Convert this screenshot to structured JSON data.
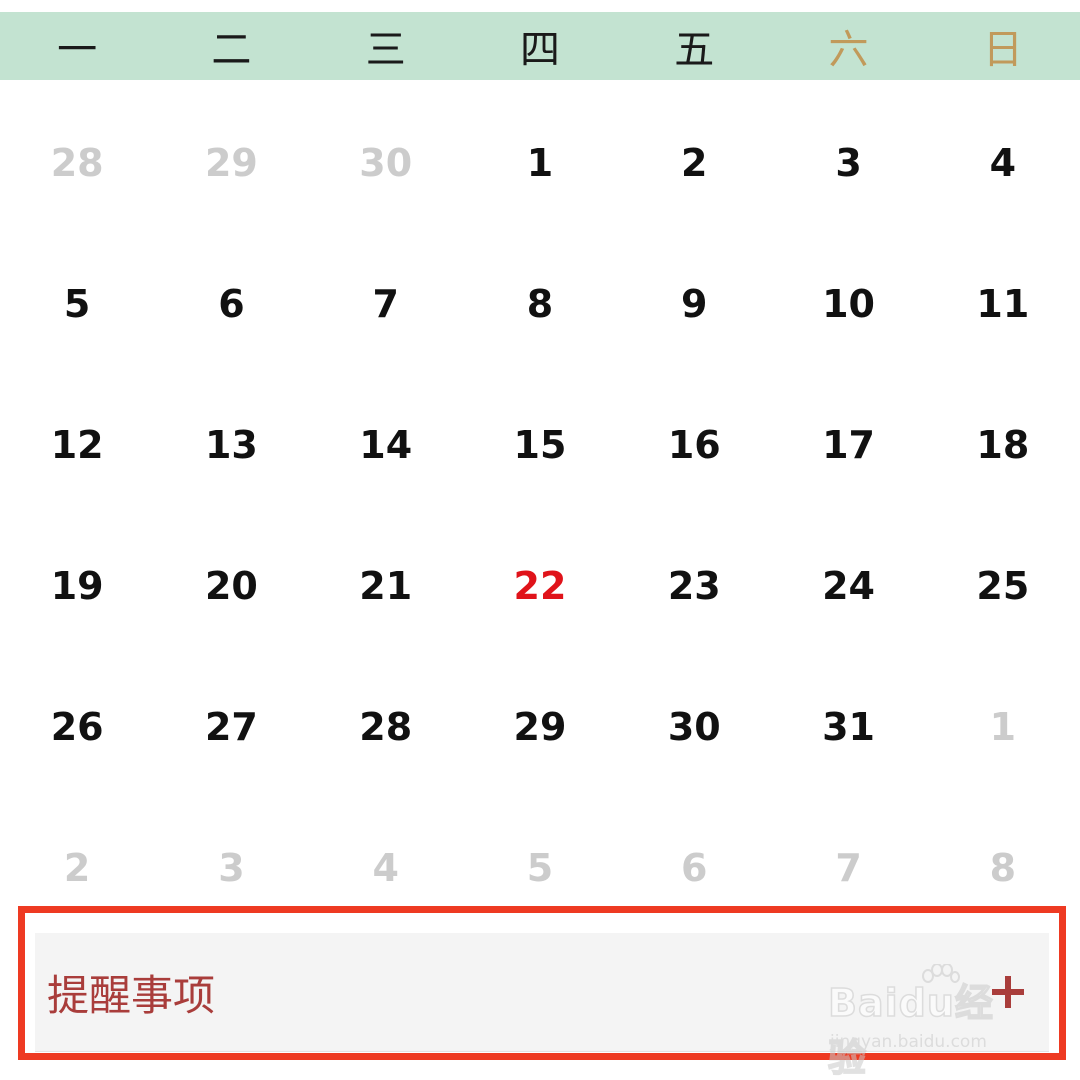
{
  "weekdays": [
    {
      "label": "一",
      "weekend": false
    },
    {
      "label": "二",
      "weekend": false
    },
    {
      "label": "三",
      "weekend": false
    },
    {
      "label": "四",
      "weekend": false
    },
    {
      "label": "五",
      "weekend": false
    },
    {
      "label": "六",
      "weekend": true
    },
    {
      "label": "日",
      "weekend": true
    }
  ],
  "days": [
    {
      "label": "28",
      "state": "muted"
    },
    {
      "label": "29",
      "state": "muted"
    },
    {
      "label": "30",
      "state": "muted"
    },
    {
      "label": "1",
      "state": "normal"
    },
    {
      "label": "2",
      "state": "normal"
    },
    {
      "label": "3",
      "state": "normal"
    },
    {
      "label": "4",
      "state": "normal"
    },
    {
      "label": "5",
      "state": "normal"
    },
    {
      "label": "6",
      "state": "normal"
    },
    {
      "label": "7",
      "state": "normal"
    },
    {
      "label": "8",
      "state": "normal"
    },
    {
      "label": "9",
      "state": "normal"
    },
    {
      "label": "10",
      "state": "normal"
    },
    {
      "label": "11",
      "state": "normal"
    },
    {
      "label": "12",
      "state": "normal"
    },
    {
      "label": "13",
      "state": "normal"
    },
    {
      "label": "14",
      "state": "normal"
    },
    {
      "label": "15",
      "state": "normal"
    },
    {
      "label": "16",
      "state": "normal"
    },
    {
      "label": "17",
      "state": "normal"
    },
    {
      "label": "18",
      "state": "normal"
    },
    {
      "label": "19",
      "state": "normal"
    },
    {
      "label": "20",
      "state": "normal"
    },
    {
      "label": "21",
      "state": "normal"
    },
    {
      "label": "22",
      "state": "today"
    },
    {
      "label": "23",
      "state": "normal"
    },
    {
      "label": "24",
      "state": "normal"
    },
    {
      "label": "25",
      "state": "normal"
    },
    {
      "label": "26",
      "state": "normal"
    },
    {
      "label": "27",
      "state": "normal"
    },
    {
      "label": "28",
      "state": "normal"
    },
    {
      "label": "29",
      "state": "normal"
    },
    {
      "label": "30",
      "state": "normal"
    },
    {
      "label": "31",
      "state": "normal"
    },
    {
      "label": "1",
      "state": "muted"
    },
    {
      "label": "2",
      "state": "muted"
    },
    {
      "label": "3",
      "state": "muted"
    },
    {
      "label": "4",
      "state": "muted"
    },
    {
      "label": "5",
      "state": "muted"
    },
    {
      "label": "6",
      "state": "muted"
    },
    {
      "label": "7",
      "state": "muted"
    },
    {
      "label": "8",
      "state": "muted"
    }
  ],
  "reminder": {
    "title": "提醒事项",
    "add_icon": "plus-icon"
  },
  "watermark": {
    "main": "Baidu经验",
    "sub": "jingyan.baidu.com"
  },
  "colors": {
    "header_bg": "#c3e3d1",
    "weekend": "#c19a5b",
    "today": "#e0131a",
    "muted": "#cccccc",
    "highlight_border": "#ee3a22",
    "reminder_text": "#a93d3b"
  }
}
